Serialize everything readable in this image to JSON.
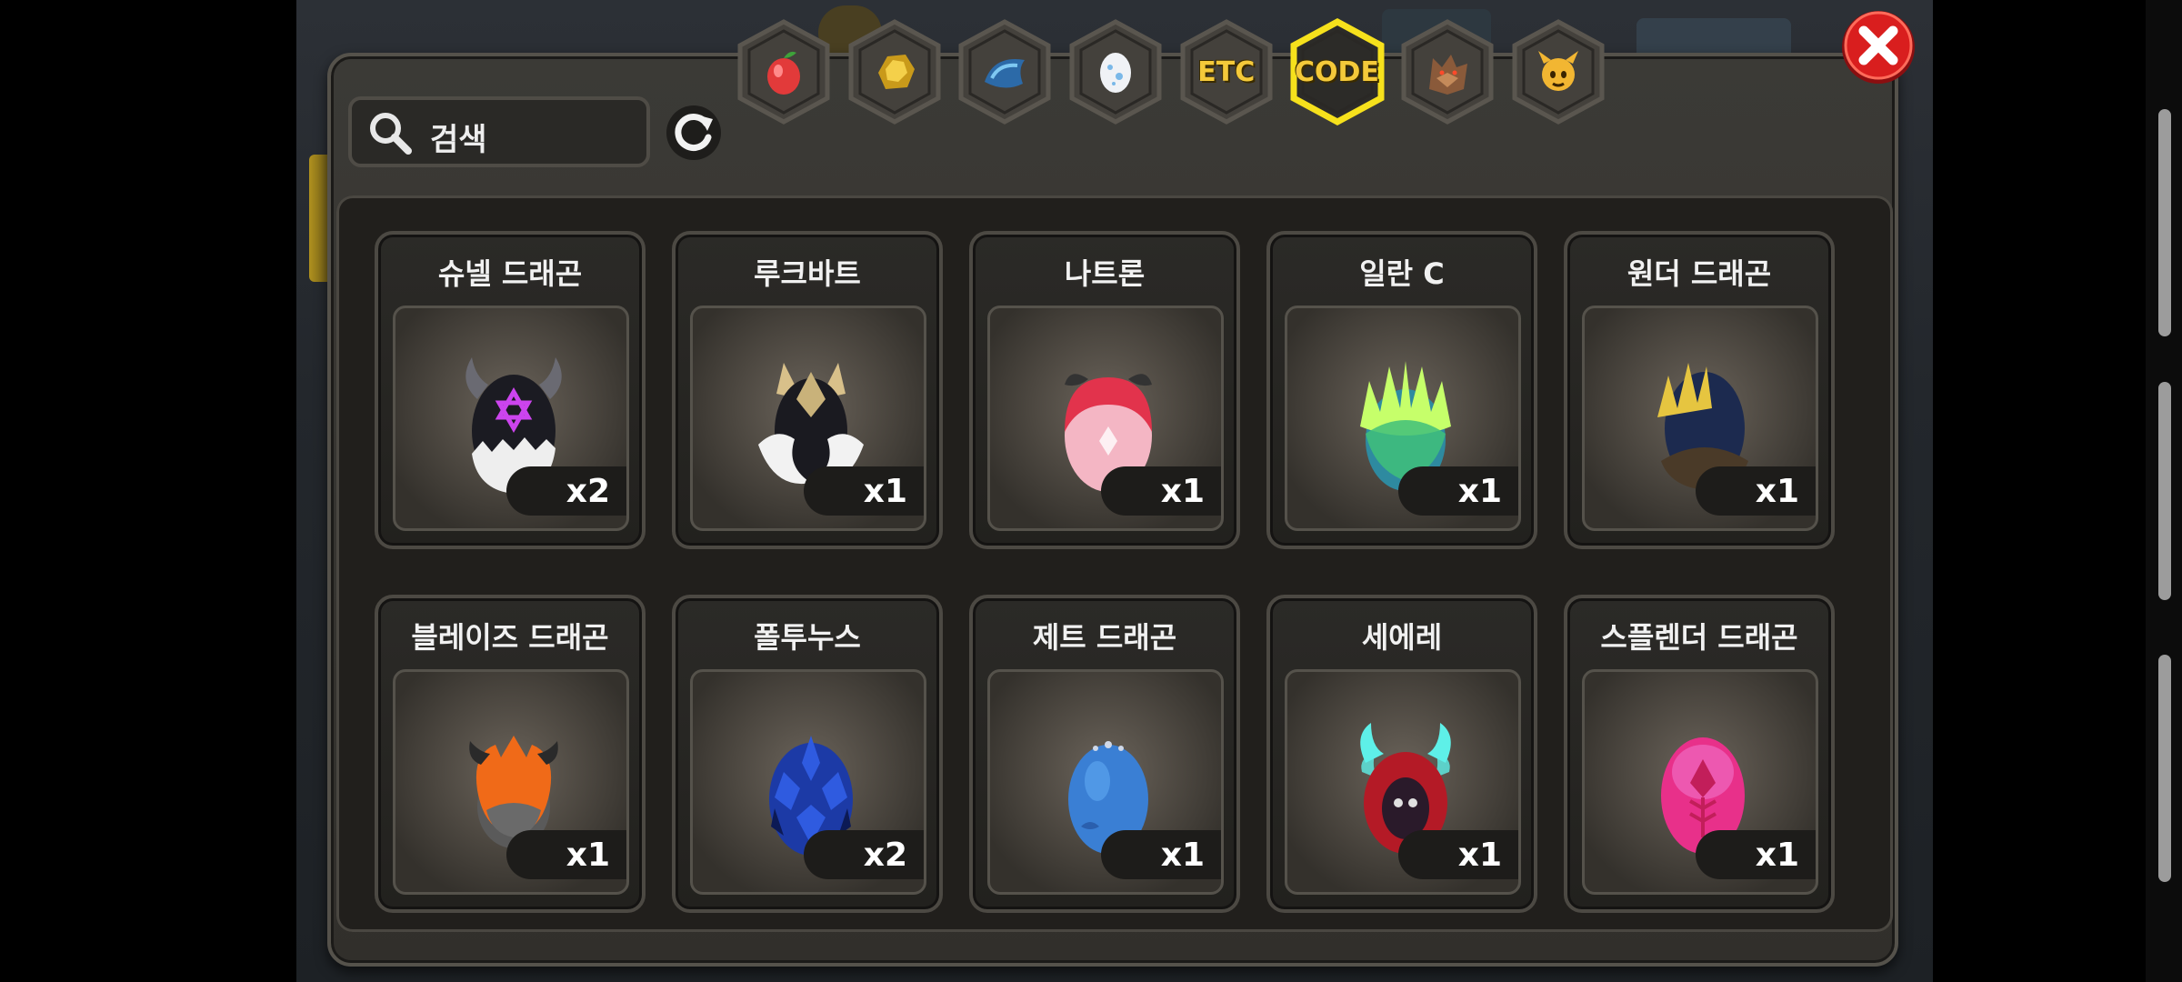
{
  "search": {
    "placeholder": "검색"
  },
  "tabs": [
    {
      "name": "fruit-tab",
      "icon": "red-fruit-icon",
      "label": "",
      "active": false
    },
    {
      "name": "gold-tab",
      "icon": "gold-nugget-icon",
      "label": "",
      "active": false
    },
    {
      "name": "dragon-scale-tab",
      "icon": "blue-scale-icon",
      "label": "",
      "active": false
    },
    {
      "name": "egg-tab",
      "icon": "egg-icon",
      "label": "",
      "active": false
    },
    {
      "name": "etc-tab",
      "icon": "",
      "label": "ETC",
      "active": false
    },
    {
      "name": "code-tab",
      "icon": "",
      "label": "CODE",
      "active": true
    },
    {
      "name": "beast-tab",
      "icon": "wolf-head-icon",
      "label": "",
      "active": false
    },
    {
      "name": "mascot-tab",
      "icon": "horned-mascot-icon",
      "label": "",
      "active": false
    }
  ],
  "items": [
    {
      "name": "슈넬 드래곤",
      "count": "x2",
      "egg": {
        "base": "#1b1b22",
        "shell": "#eeeeee",
        "accent": "#cc44ee",
        "type": "horns-star"
      }
    },
    {
      "name": "루크바트",
      "count": "x1",
      "egg": {
        "base": "#1a1a20",
        "shell": "#f2f2f2",
        "accent": "#c9b27a",
        "type": "wings-white"
      }
    },
    {
      "name": "나트론",
      "count": "x1",
      "egg": {
        "base": "#f4b6c4",
        "shell": "#e2334c",
        "accent": "#ffffff",
        "type": "pink-ribbon"
      }
    },
    {
      "name": "일란 C",
      "count": "x1",
      "egg": {
        "base": "#2e8aa0",
        "shell": "#3fbf7a",
        "accent": "#c6ff6a",
        "type": "leaf-crown"
      }
    },
    {
      "name": "원더 드래곤",
      "count": "x1",
      "egg": {
        "base": "#1c2a4f",
        "shell": "#4a3a28",
        "accent": "#e6c540",
        "type": "gold-crown"
      }
    },
    {
      "name": "블레이즈 드래곤",
      "count": "x1",
      "egg": {
        "base": "#5a5a5a",
        "shell": "#f06a18",
        "accent": "#2a2a2a",
        "type": "flame"
      }
    },
    {
      "name": "폴투누스",
      "count": "x2",
      "egg": {
        "base": "#1c3aa6",
        "shell": "#2f5be0",
        "accent": "#0c1a55",
        "type": "spiked-blue"
      }
    },
    {
      "name": "제트 드래곤",
      "count": "x1",
      "egg": {
        "base": "#3a7fd4",
        "shell": "#5aa2ee",
        "accent": "#2a5fae",
        "type": "plain-blue"
      }
    },
    {
      "name": "세에레",
      "count": "x1",
      "egg": {
        "base": "#b41a26",
        "shell": "#5ef0e8",
        "accent": "#2a1a2a",
        "type": "hood"
      }
    },
    {
      "name": "스플렌더 드래곤",
      "count": "x1",
      "egg": {
        "base": "#e8308a",
        "shell": "#f06ac0",
        "accent": "#c21e5a",
        "type": "pink-leaf"
      }
    }
  ],
  "colors": {
    "accent_gold": "#f4c93a",
    "close_red": "#d91e1e",
    "panel": "#3b3a36"
  }
}
